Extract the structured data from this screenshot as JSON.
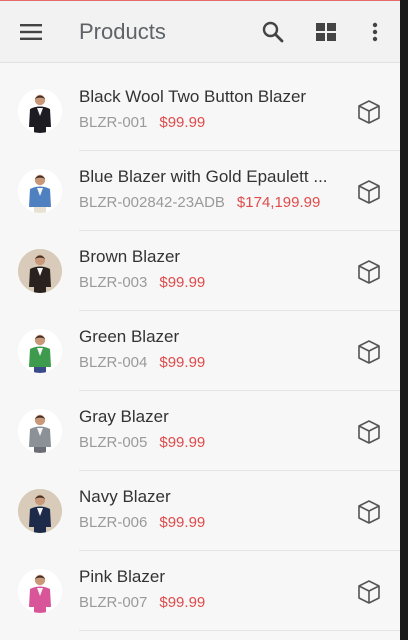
{
  "toolbar": {
    "title": "Products",
    "menu_icon": "hamburger-menu-icon",
    "search_icon": "search-icon",
    "view_icon": "grid-view-icon",
    "more_icon": "more-vert-icon"
  },
  "products": [
    {
      "name": "Black Wool Two Button Blazer",
      "sku": "BLZR-001",
      "price": "$99.99",
      "jacket_color": "#1c1c22",
      "pants_color": "#1c1c22",
      "avatar_bg": "#ffffff"
    },
    {
      "name": "Blue Blazer with Gold Epaulett ...",
      "sku": "BLZR-002842-23ADB",
      "price": "$174,199.99",
      "jacket_color": "#4f80c0",
      "pants_color": "#e8e2d4",
      "avatar_bg": "#ffffff"
    },
    {
      "name": "Brown Blazer",
      "sku": "BLZR-003",
      "price": "$99.99",
      "jacket_color": "#2a221e",
      "pants_color": "#2a221e",
      "avatar_bg": "#d8cbb9"
    },
    {
      "name": "Green Blazer",
      "sku": "BLZR-004",
      "price": "$99.99",
      "jacket_color": "#3e9a4c",
      "pants_color": "#3b4a8a",
      "avatar_bg": "#ffffff"
    },
    {
      "name": "Gray Blazer",
      "sku": "BLZR-005",
      "price": "$99.99",
      "jacket_color": "#8c9097",
      "pants_color": "#6a6e74",
      "avatar_bg": "#ffffff"
    },
    {
      "name": "Navy Blazer",
      "sku": "BLZR-006",
      "price": "$99.99",
      "jacket_color": "#1e2a4a",
      "pants_color": "#1e2a4a",
      "avatar_bg": "#d8cbb9"
    },
    {
      "name": "Pink Blazer",
      "sku": "BLZR-007",
      "price": "$99.99",
      "jacket_color": "#d9559a",
      "pants_color": "#d9559a",
      "avatar_bg": "#ffffff"
    }
  ],
  "row_action_icon": "cube-icon",
  "colors": {
    "title": "#5f6368",
    "price": "#e14b4b",
    "sku": "#9a9a9a",
    "toolbar_bg": "#f2f2f2"
  }
}
